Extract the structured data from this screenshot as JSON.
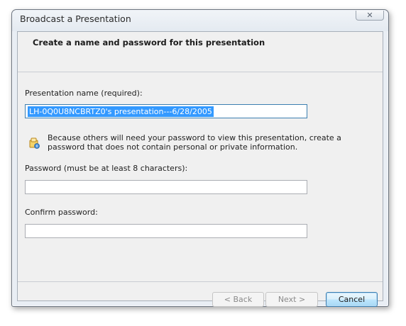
{
  "window": {
    "title": "Broadcast a Presentation",
    "close_glyph": "✕"
  },
  "header": {
    "title": "Create a name and password for this presentation"
  },
  "form": {
    "name_label": "Presentation name (required):",
    "name_value": "LH-0Q0U8NCBRTZ0's presentation---6/28/2005",
    "info_text": "Because others will need your password to view this presentation, create a password that does not contain personal or private information.",
    "password_label": "Password (must be at least 8 characters):",
    "password_value": "",
    "confirm_label": "Confirm password:",
    "confirm_value": ""
  },
  "buttons": {
    "back": "< Back",
    "next": "Next >",
    "cancel": "Cancel"
  },
  "colors": {
    "selection": "#3399ff",
    "focus_border": "#3c7fb1",
    "icon_tint": "#e8b320"
  },
  "icons": {
    "info": "info-shield-icon",
    "close": "close-icon"
  }
}
